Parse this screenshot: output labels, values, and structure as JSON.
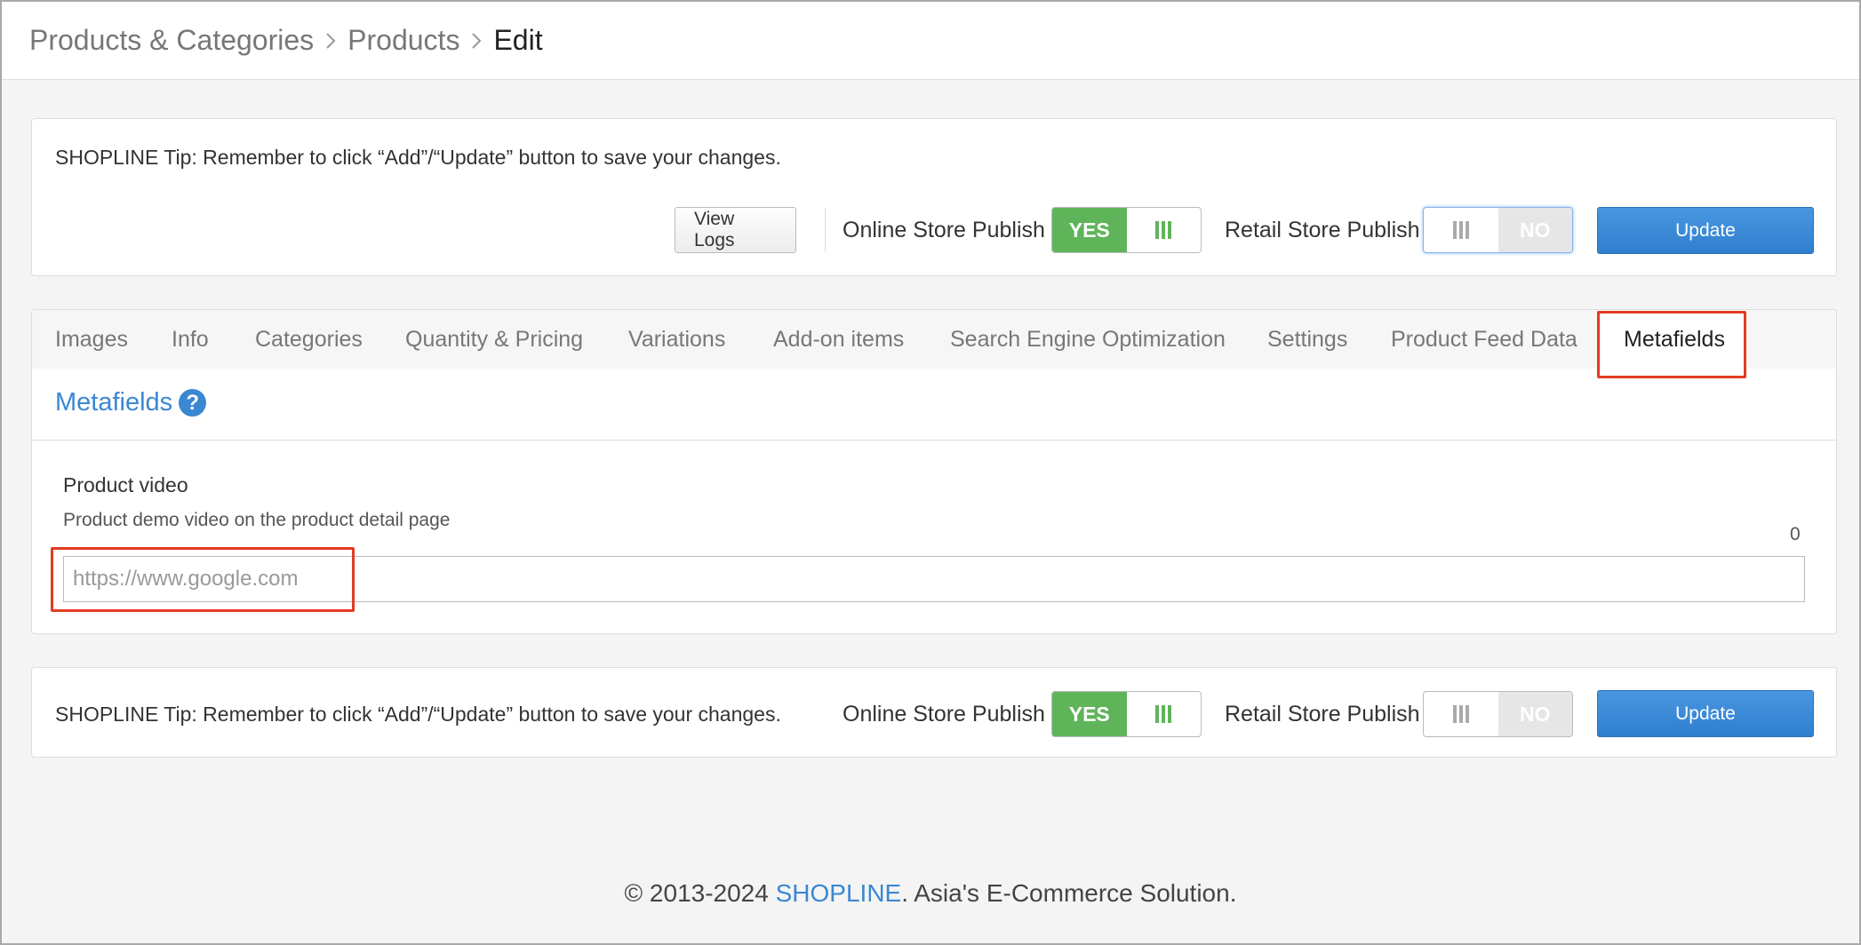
{
  "breadcrumb": {
    "items": [
      "Products & Categories",
      "Products"
    ],
    "current": "Edit"
  },
  "top_panel": {
    "tip": "SHOPLINE Tip: Remember to click “Add”/“Update” button to save your changes.",
    "view_logs_label": "View Logs",
    "online_store_label": "Online Store Publish",
    "online_store_value": "YES",
    "retail_store_label": "Retail Store Publish",
    "retail_store_value": "NO",
    "update_label": "Update"
  },
  "tabs": [
    {
      "label": "Images"
    },
    {
      "label": "Info"
    },
    {
      "label": "Categories"
    },
    {
      "label": "Quantity & Pricing"
    },
    {
      "label": "Variations"
    },
    {
      "label": "Add-on items"
    },
    {
      "label": "Search Engine Optimization"
    },
    {
      "label": "Settings"
    },
    {
      "label": "Product Feed Data"
    },
    {
      "label": "Metafields"
    }
  ],
  "active_tab": "Metafields",
  "metafields": {
    "title": "Metafields",
    "help": "?",
    "field_label": "Product video",
    "field_description": "Product demo video on the product detail page",
    "char_count": "0",
    "input_value": "",
    "input_placeholder": "https://www.google.com"
  },
  "bottom_panel": {
    "tip": "SHOPLINE Tip: Remember to click “Add”/“Update” button to save your changes.",
    "online_store_label": "Online Store Publish",
    "online_store_value": "YES",
    "retail_store_label": "Retail Store Publish",
    "retail_store_value": "NO",
    "update_label": "Update"
  },
  "footer": {
    "prefix": "© 2013-2024 ",
    "brand": "SHOPLINE",
    "suffix": ". Asia's E-Commerce Solution."
  },
  "colors": {
    "accent": "#3a87d2",
    "toggle_on": "#5fb45a",
    "update_button": "#2f7fcf",
    "annotation": "#e23b22"
  }
}
